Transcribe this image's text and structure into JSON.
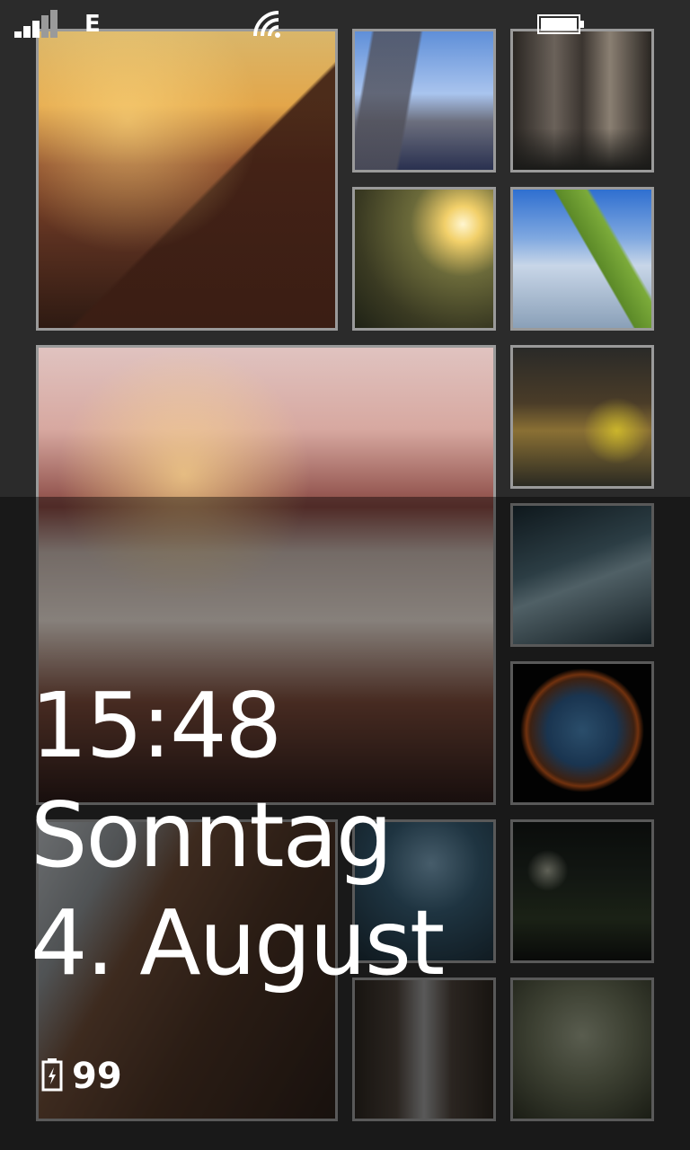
{
  "status_bar": {
    "network_type": "E",
    "icons": [
      "signal-strength-icon",
      "wifi-icon",
      "battery-icon"
    ]
  },
  "lock_screen": {
    "time": "15:48",
    "weekday": "Sonntag",
    "date": "4. August",
    "battery_percent": "99"
  },
  "photo_tiles": [
    {
      "name": "pagoda-wall-sunset"
    },
    {
      "name": "tower-bridge"
    },
    {
      "name": "cathedral-interior"
    },
    {
      "name": "sunburst-ruins"
    },
    {
      "name": "grasshopper-blue-sky"
    },
    {
      "name": "tugboat-leo"
    },
    {
      "name": "excavator-night"
    },
    {
      "name": "forest-light-rays"
    },
    {
      "name": "earth-globe"
    },
    {
      "name": "rusty-ship-hull"
    },
    {
      "name": "samurai-silhouette"
    },
    {
      "name": "night-bridge"
    },
    {
      "name": "narrow-alley"
    },
    {
      "name": "raindrops-glass"
    }
  ],
  "colors": {
    "background": "#2b2b2b",
    "tile_border": "#9a9a9a",
    "text": "#ffffff"
  }
}
